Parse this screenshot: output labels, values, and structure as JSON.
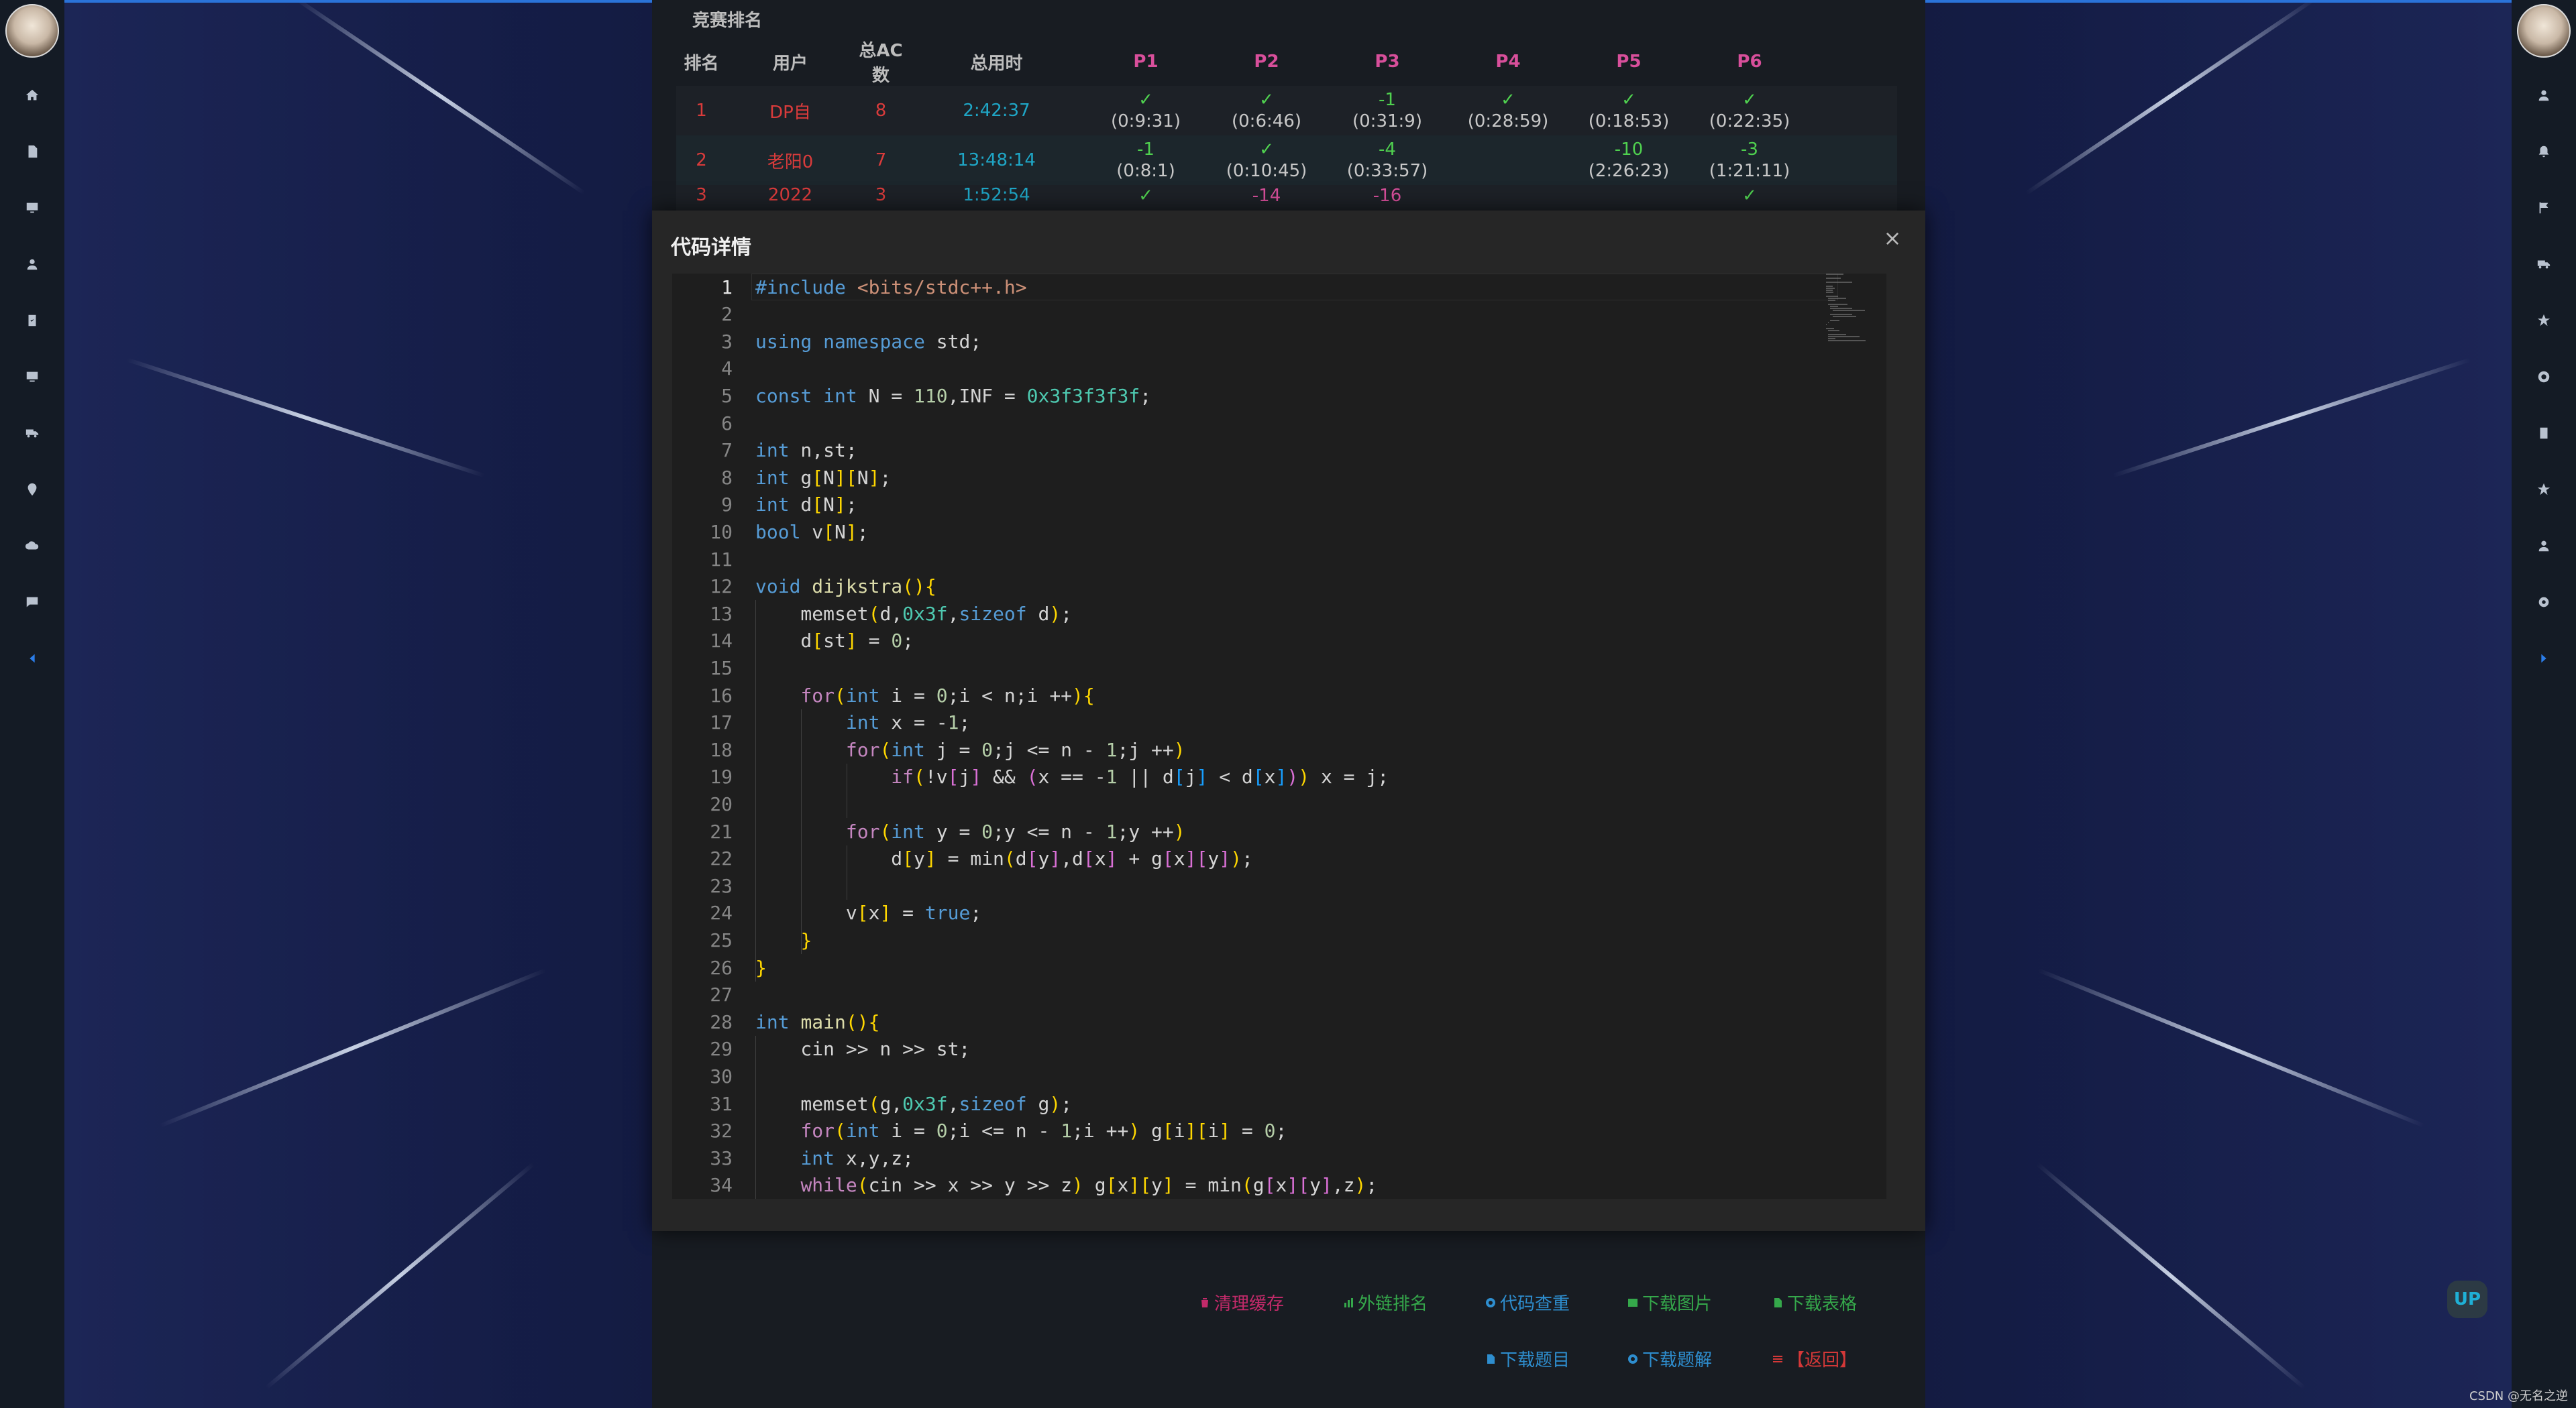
{
  "contest": {
    "title": "竞赛排名",
    "headers": {
      "rank": "排名",
      "user": "用户",
      "ac": "总AC数",
      "time": "总用时",
      "problems": [
        "P1",
        "P2",
        "P3",
        "P4",
        "P5",
        "P6"
      ]
    },
    "rows": [
      {
        "rank": "1",
        "user": "DP自",
        "ac": "8",
        "time": "2:42:37",
        "cells": [
          [
            "✓",
            "(0:9:31)"
          ],
          [
            "✓",
            "(0:6:46)"
          ],
          [
            "-1",
            "(0:31:9)"
          ],
          [
            "✓",
            "(0:28:59)"
          ],
          [
            "✓",
            "(0:18:53)"
          ],
          [
            "✓",
            "(0:22:35)"
          ]
        ]
      },
      {
        "rank": "2",
        "user": "老阳0",
        "ac": "7",
        "time": "13:48:14",
        "cells": [
          [
            "-1",
            "(0:8:1)"
          ],
          [
            "✓",
            "(0:10:45)"
          ],
          [
            "-4",
            "(0:33:57)"
          ],
          [
            "",
            ""
          ],
          [
            "-10",
            "(2:26:23)"
          ],
          [
            "-3",
            "(1:21:11)"
          ]
        ]
      },
      {
        "rank": "3",
        "user": "2022",
        "ac": "3",
        "time": "1:52:54",
        "cells": [
          [
            "✓",
            ""
          ],
          [
            "-14",
            ""
          ],
          [
            "-16",
            ""
          ],
          [
            "",
            ""
          ],
          [
            "",
            ""
          ],
          [
            "✓",
            ""
          ]
        ]
      }
    ]
  },
  "modal": {
    "title": "代码详情",
    "close_label": "×",
    "language": "cpp",
    "code_lines": [
      "#include <bits/stdc++.h>",
      "",
      "using namespace std;",
      "",
      "const int N = 110,INF = 0x3f3f3f3f;",
      "",
      "int n,st;",
      "int g[N][N];",
      "int d[N];",
      "bool v[N];",
      "",
      "void dijkstra(){",
      "    memset(d,0x3f,sizeof d);",
      "    d[st] = 0;",
      "",
      "    for(int i = 0;i < n;i ++){",
      "        int x = -1;",
      "        for(int j = 0;j <= n - 1;j ++)",
      "            if(!v[j] && (x == -1 || d[j] < d[x])) x = j;",
      "",
      "        for(int y = 0;y <= n - 1;y ++)",
      "            d[y] = min(d[y],d[x] + g[x][y]);",
      "",
      "        v[x] = true;",
      "    }",
      "}",
      "",
      "int main(){",
      "    cin >> n >> st;",
      "",
      "    memset(g,0x3f,sizeof g);",
      "    for(int i = 0;i <= n - 1;i ++) g[i][i] = 0;",
      "    int x,y,z;",
      "    while(cin >> x >> y >> z) g[x][y] = min(g[x][y],z);"
    ]
  },
  "footer": {
    "clear_cache": "清理缓存",
    "external_rank": "外链排名",
    "code_check": "代码查重",
    "download_image": "下载图片",
    "download_table": "下载表格",
    "download_problems": "下载题目",
    "download_solutions": "下载题解",
    "back": "【返回】"
  },
  "up_button": "UP",
  "watermark": "CSDN @无名之逆",
  "colors": {
    "accent": "#2a73d9",
    "ac_green": "#4fd04f",
    "fail_green": "#4fd04f",
    "rank_red": "#d93b3b",
    "time_cyan": "#1fa6c6",
    "problem_pink": "#d84f9b"
  }
}
